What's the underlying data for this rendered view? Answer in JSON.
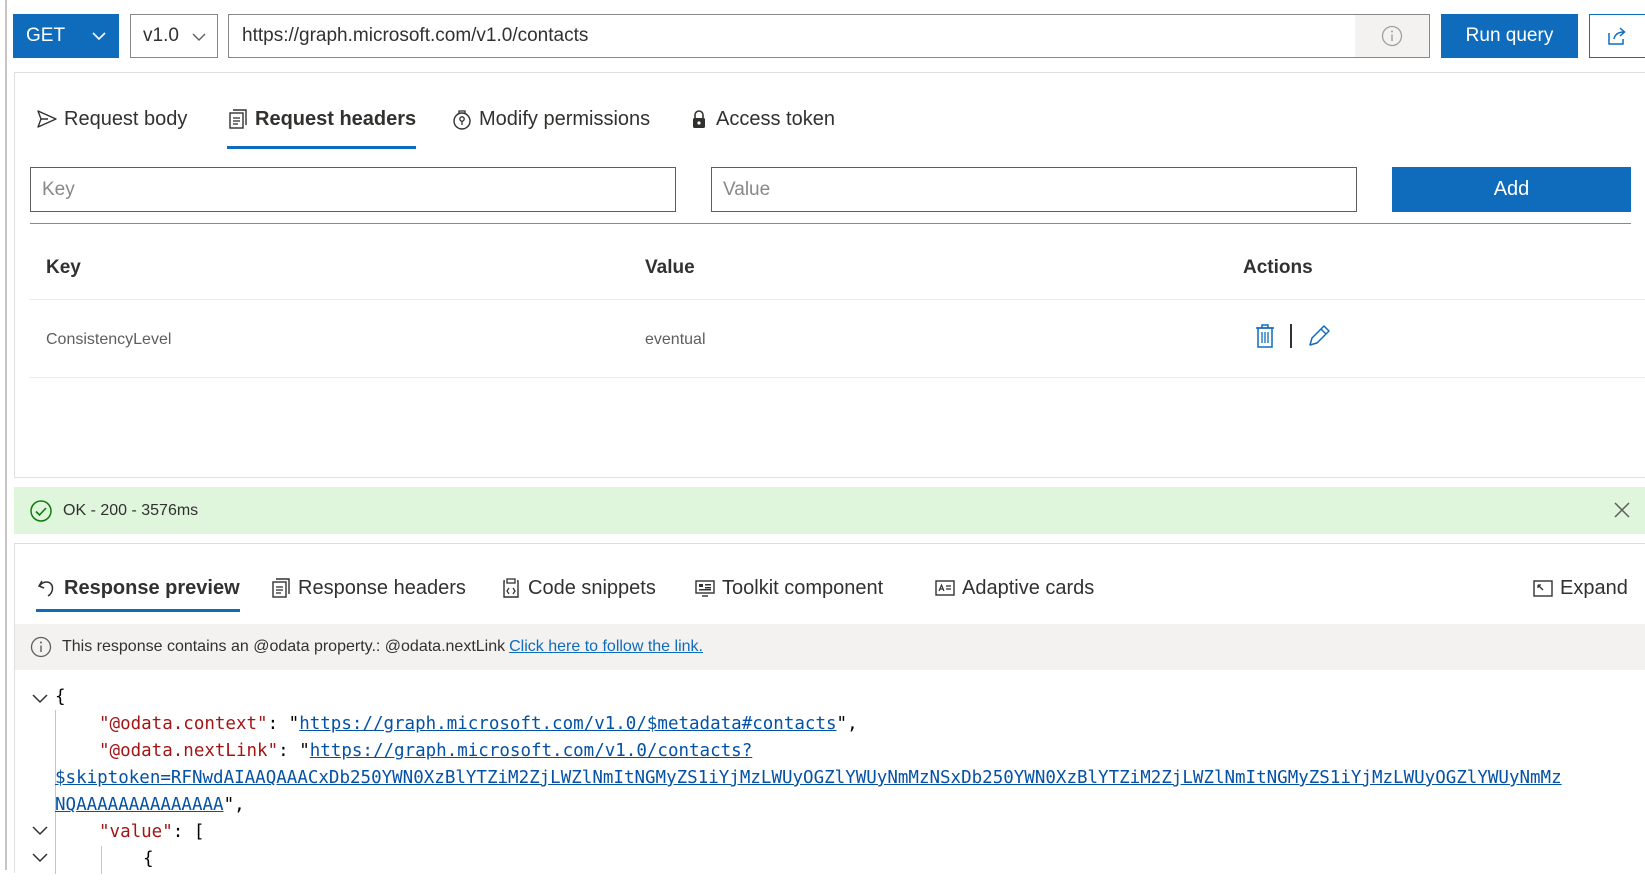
{
  "query": {
    "method": "GET",
    "version": "v1.0",
    "url": "https://graph.microsoft.com/v1.0/contacts",
    "run_label": "Run query"
  },
  "request_tabs": [
    {
      "label": "Request body",
      "icon": "send-icon"
    },
    {
      "label": "Request headers",
      "icon": "headers-icon",
      "active": true
    },
    {
      "label": "Modify permissions",
      "icon": "permissions-icon"
    },
    {
      "label": "Access token",
      "icon": "token-lock-icon"
    }
  ],
  "header_form": {
    "key_placeholder": "Key",
    "value_placeholder": "Value",
    "add_label": "Add"
  },
  "headers_table": {
    "columns": [
      "Key",
      "Value",
      "Actions"
    ],
    "rows": [
      {
        "key": "ConsistencyLevel",
        "value": "eventual"
      }
    ]
  },
  "status": {
    "text": "OK - 200 - 3576ms",
    "color": "#dff6dd"
  },
  "response_tabs": [
    {
      "label": "Response preview",
      "icon": "undo-arrow-icon",
      "active": true
    },
    {
      "label": "Response headers",
      "icon": "headers-icon"
    },
    {
      "label": "Code snippets",
      "icon": "code-snippet-icon"
    },
    {
      "label": "Toolkit component",
      "icon": "toolkit-icon"
    },
    {
      "label": "Adaptive cards",
      "icon": "adaptive-card-icon"
    }
  ],
  "expand_label": "Expand",
  "notice": {
    "text": "This response contains an @odata property.: @odata.nextLink",
    "link_text": "Click here to follow the link."
  },
  "json_preview": {
    "open_brace": "{",
    "context_key": "\"@odata.context\"",
    "context_value": "https://graph.microsoft.com/v1.0/$metadata#contacts",
    "nextlink_key": "\"@odata.nextLink\"",
    "nextlink_value_1": "https://graph.microsoft.com/v1.0/contacts?",
    "nextlink_value_2": "$skiptoken=RFNwdAIAAQAAACxDb250YWN0XzBlYTZiM2ZjLWZlNmItNGMyZS1iYjMzLWUyOGZlYWUyNmMzNSxDb250YWN0XzBlYTZiM2ZjLWZlNmItNGMyZS1iYjMzLWUyOGZlYWUyNmMz",
    "nextlink_value_3": "NQAAAAAAAAAAAAAA",
    "value_key": "\"value\"",
    "value_open": "[",
    "item_open": "{"
  },
  "colors": {
    "accent": "#0f6cbd",
    "status_bg": "#dff6dd",
    "json_key": "#a31515",
    "json_link": "#0451a5"
  }
}
